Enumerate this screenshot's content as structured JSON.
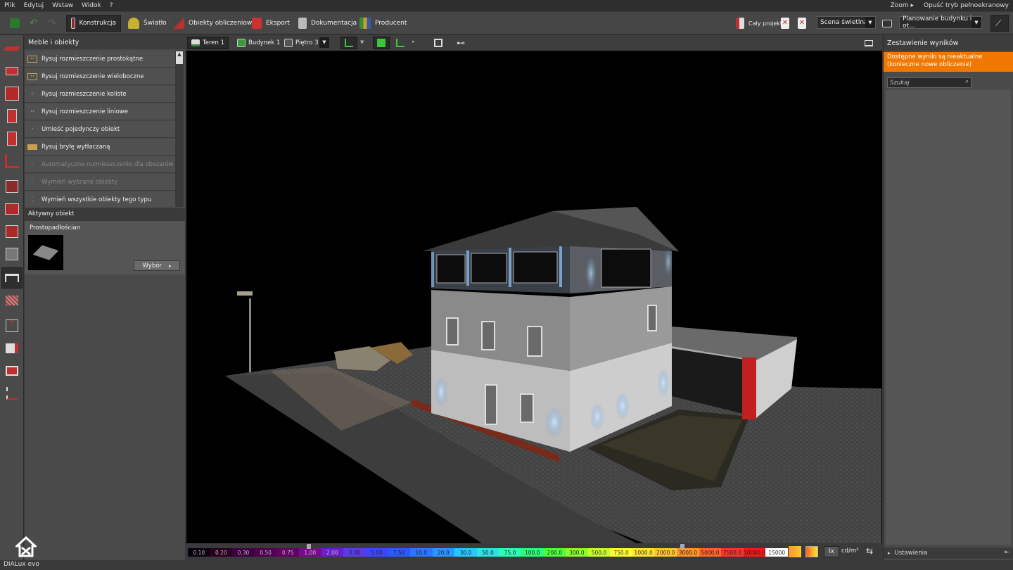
{
  "menu": [
    "Plik",
    "Edytuj",
    "Wstaw",
    "Widok",
    "?"
  ],
  "menu_right": {
    "zoom": "Zoom",
    "exit_fullscreen": "Opuść tryb pełnoekranowy"
  },
  "toolbar": {
    "tabs": [
      {
        "label": "Konstrukcja",
        "icon": "construction-icon"
      },
      {
        "label": "Światło",
        "icon": "light-icon"
      },
      {
        "label": "Obiekty obliczeniowe",
        "icon": "calc-objects-icon"
      },
      {
        "label": "Eksport",
        "icon": "export-icon"
      },
      {
        "label": "Dokumentacja",
        "icon": "documentation-icon"
      },
      {
        "label": "Producent",
        "icon": "manufacturer-icon"
      }
    ],
    "whole_project": "Cały projekt",
    "scene": "Scena świetlna 1",
    "planning": "Planowanie budynku i ot..."
  },
  "left_panel": {
    "title": "Meble i obiekty",
    "items": [
      {
        "label": "Rysuj rozmieszczenie prostokątne",
        "enabled": true
      },
      {
        "label": "Rysuj rozmieszczenie wieloboczne",
        "enabled": true
      },
      {
        "label": "Rysuj rozmieszczenie koliste",
        "enabled": true
      },
      {
        "label": "Rysuj rozmieszczenie liniowe",
        "enabled": true
      },
      {
        "label": "Umieść pojedynczy obiekt",
        "enabled": true
      },
      {
        "label": "Rysuj bryłę wytłaczaną",
        "enabled": true
      },
      {
        "label": "Automatyczne rozmieszczenie dla obszarów",
        "enabled": false
      },
      {
        "label": "Wymień wybrane obiekty",
        "enabled": false
      },
      {
        "label": "Wymień wszystkie obiekty tego typu",
        "enabled": true
      }
    ],
    "active_object_header": "Aktywny obiekt",
    "active_object_name": "Prostopadłościan",
    "select_button": "Wybór"
  },
  "viewport_bar": {
    "terrain": "Teren 1",
    "building": "Budynek 1",
    "floor": "Piętro 3"
  },
  "right_panel": {
    "title": "Zestawienie wyników",
    "warning": "Dostępne wyniki są nieaktualne (konieczne nowe obliczenie)",
    "search_placeholder": "Szukaj",
    "settings": "Ustawienia"
  },
  "colorbar": {
    "values": [
      "0.10",
      "0.20",
      "0.30",
      "0.50",
      "0.75",
      "1.00",
      "2.00",
      "3.00",
      "5.00",
      "7.50",
      "10.0",
      "20.0",
      "30.0",
      "50.0",
      "75.0",
      "100.0",
      "200.0",
      "300.0",
      "500.0",
      "750.0",
      "1000.0",
      "2000.0",
      "3000.0",
      "5000.0",
      "7500.0",
      "10000.0",
      "15000"
    ],
    "colors": [
      "#0a0010",
      "#280020",
      "#3c0040",
      "#500050",
      "#640064",
      "#780a8c",
      "#6a1fc8",
      "#5a3be6",
      "#3c46ff",
      "#2a5aff",
      "#2878ff",
      "#2896ff",
      "#28c8ff",
      "#28e6e6",
      "#28ffb4",
      "#28ff78",
      "#50ff3c",
      "#8cff28",
      "#c8ff28",
      "#ffff28",
      "#ffe628",
      "#ffc828",
      "#ff9628",
      "#ff6428",
      "#ff3228",
      "#ff1414",
      "#ffffff"
    ],
    "unit_lx": "lx",
    "unit_cd": "cd/m²"
  },
  "brand": "DIALux evo"
}
